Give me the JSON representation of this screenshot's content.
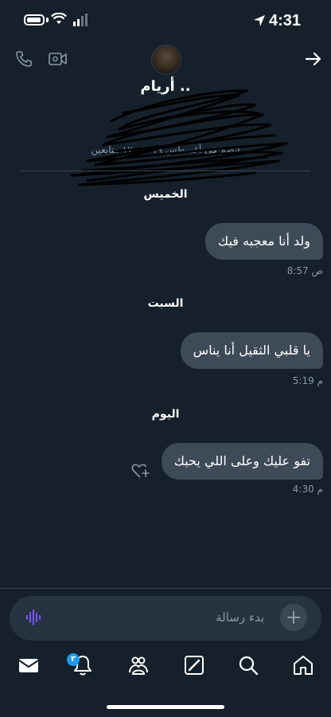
{
  "status_bar": {
    "time": "4:31"
  },
  "header": {
    "contact_name": "أريام ..",
    "joined_text": "انضم في أغسطس ٢٠١٩ · ١٧ متابعين",
    "icons": [
      "phone-icon",
      "video-icon",
      "back-arrow-icon"
    ]
  },
  "messages": [
    {
      "date_label": "الخميس",
      "text": "ولد أنا معجبه فيك",
      "time": "8:57 ص"
    },
    {
      "date_label": "السبت",
      "text": "يا قلبي الثقيل أنا يناس",
      "time": "5:19 م"
    },
    {
      "date_label": "اليوم",
      "text": "تفو عليك وعلى اللي يحبك",
      "time": "4:30 م"
    }
  ],
  "composer": {
    "placeholder": "بدء رسالة"
  },
  "nav": {
    "notification_count": "٣",
    "items": [
      "messages-icon",
      "notifications-icon",
      "communities-icon",
      "grok-icon",
      "search-icon",
      "home-icon"
    ]
  },
  "colors": {
    "background": "#15202b",
    "bubble": "#3e4a57",
    "accent": "#1d9bf0",
    "voice": "#7856ff"
  }
}
